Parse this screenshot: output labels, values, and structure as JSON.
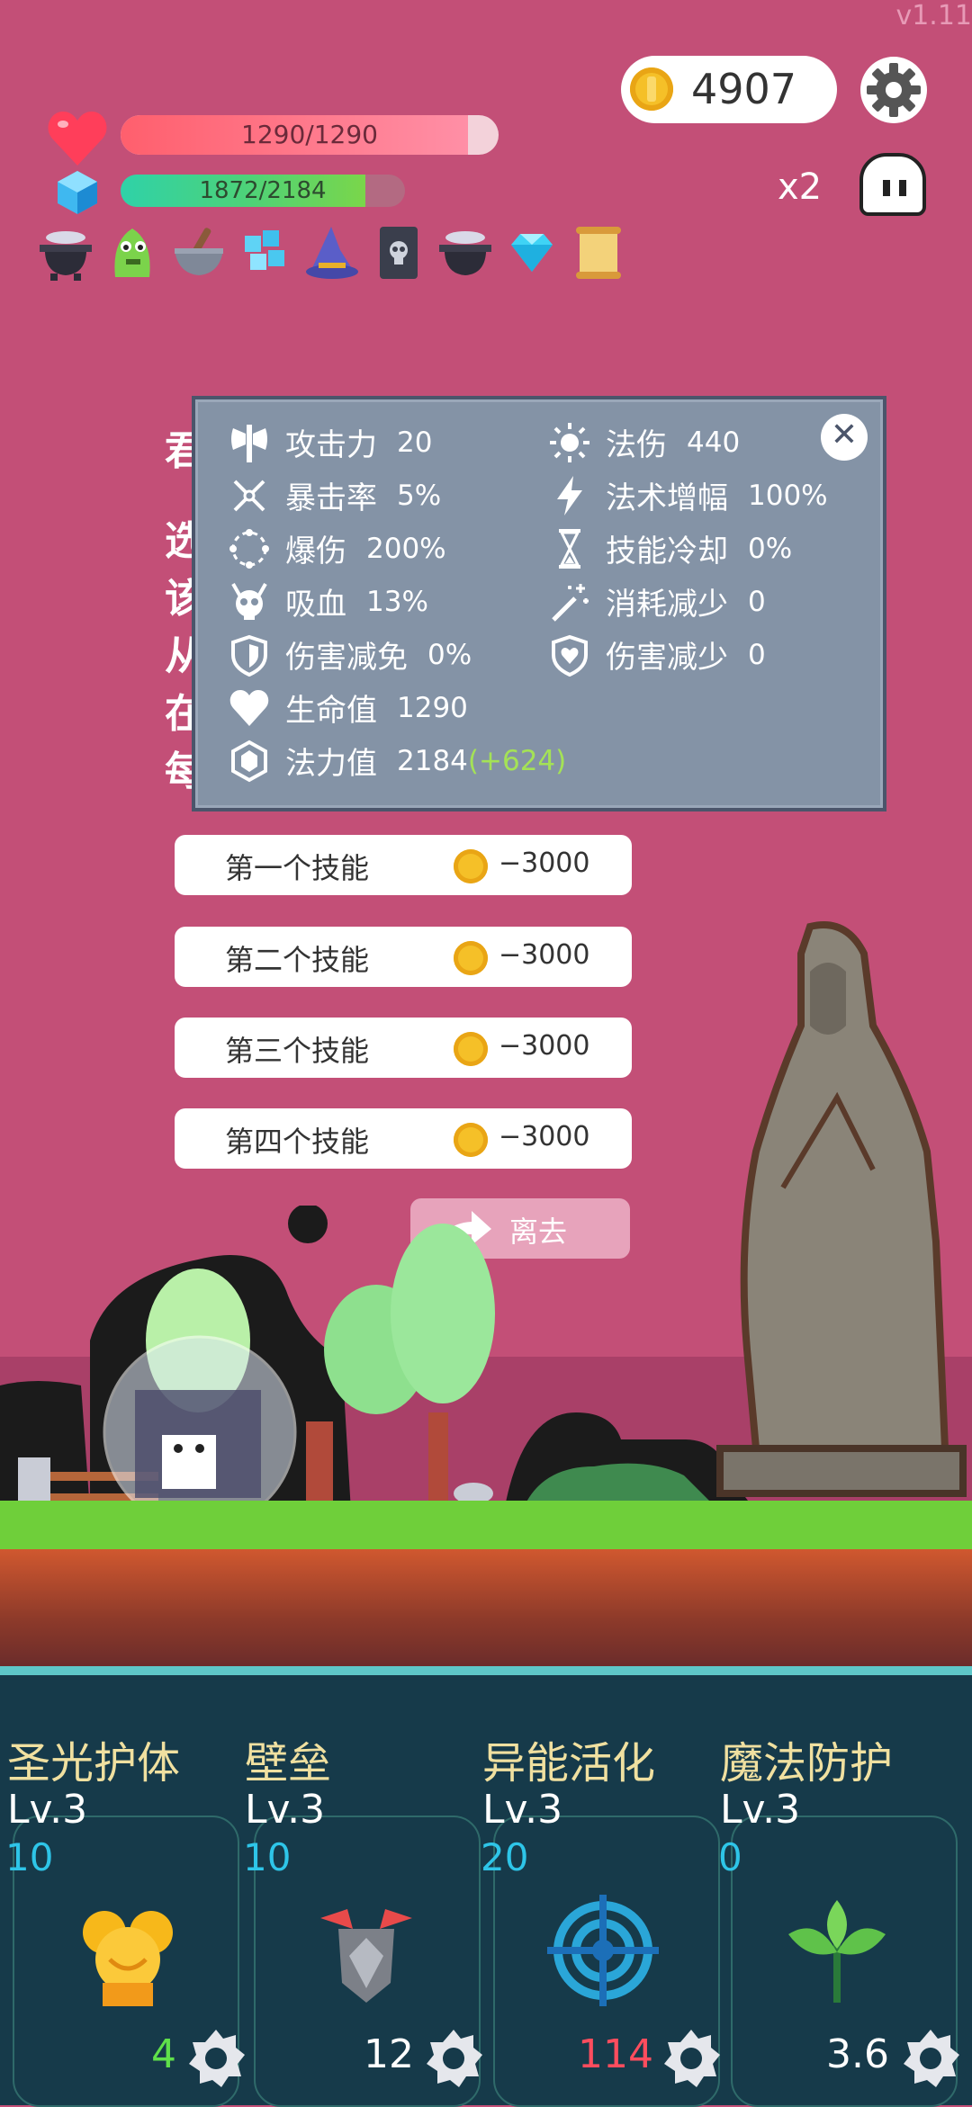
{
  "version": "v1.11",
  "coins": "4907",
  "hp_text": "1290/1290",
  "hp_fraction": 0.92,
  "mp_text": "1872/2184",
  "mp_fraction": 0.86,
  "multiplier": "x2",
  "inventory": [
    "cauldron-icon",
    "green-monster-icon",
    "mortar-icon",
    "ice-cubes-icon",
    "wizard-hat-icon",
    "skull-book-icon",
    "cauldron-icon",
    "diamond-icon",
    "scroll-icon"
  ],
  "stats": {
    "left": [
      {
        "icon": "axe-icon",
        "label": "攻击力",
        "value": "20"
      },
      {
        "icon": "crit-icon",
        "label": "暴击率",
        "value": "5%"
      },
      {
        "icon": "burst-icon",
        "label": "爆伤",
        "value": "200%"
      },
      {
        "icon": "demon-skull-icon",
        "label": "吸血",
        "value": "13%"
      },
      {
        "icon": "shield-icon",
        "label": "伤害减免",
        "value": "0%"
      },
      {
        "icon": "heart-icon",
        "label": "生命值",
        "value": "1290"
      },
      {
        "icon": "hexagon-gem-icon",
        "label": "法力值",
        "value": "2184",
        "bonus": "(+624)"
      }
    ],
    "right": [
      {
        "icon": "sun-icon",
        "label": "法伤",
        "value": "440"
      },
      {
        "icon": "lightning-icon",
        "label": "法术增幅",
        "value": "100%"
      },
      {
        "icon": "hourglass-icon",
        "label": "技能冷却",
        "value": "0%"
      },
      {
        "icon": "magic-wand-icon",
        "label": "消耗减少",
        "value": "0"
      },
      {
        "icon": "shield-heart-icon",
        "label": "伤害减少",
        "value": "0"
      }
    ]
  },
  "hidden_panel_text": [
    "君",
    "选",
    "该",
    "从",
    "在",
    "每"
  ],
  "skill_buttons": [
    {
      "label": "第一个技能",
      "cost": "−3000"
    },
    {
      "label": "第二个技能",
      "cost": "−3000"
    },
    {
      "label": "第三个技能",
      "cost": "−3000"
    },
    {
      "label": "第四个技能",
      "cost": "−3000"
    }
  ],
  "leave_label": "离去",
  "skills": [
    {
      "name": "圣光护体",
      "level": "Lv.3",
      "num": "10",
      "cost": "4",
      "cost_color": "#5fe04a",
      "icon": "golden-statue-icon"
    },
    {
      "name": "壁垒",
      "level": "Lv.3",
      "num": "10",
      "cost": "12",
      "cost_color": "#ffffff",
      "icon": "armor-icon"
    },
    {
      "name": "异能活化",
      "level": "Lv.3",
      "num": "20",
      "cost": "114",
      "cost_color": "#ff4d5e",
      "icon": "target-icon"
    },
    {
      "name": "魔法防护",
      "level": "Lv.3",
      "num": "0",
      "cost": "3.6",
      "cost_color": "#ffffff",
      "icon": "leaf-icon"
    }
  ]
}
